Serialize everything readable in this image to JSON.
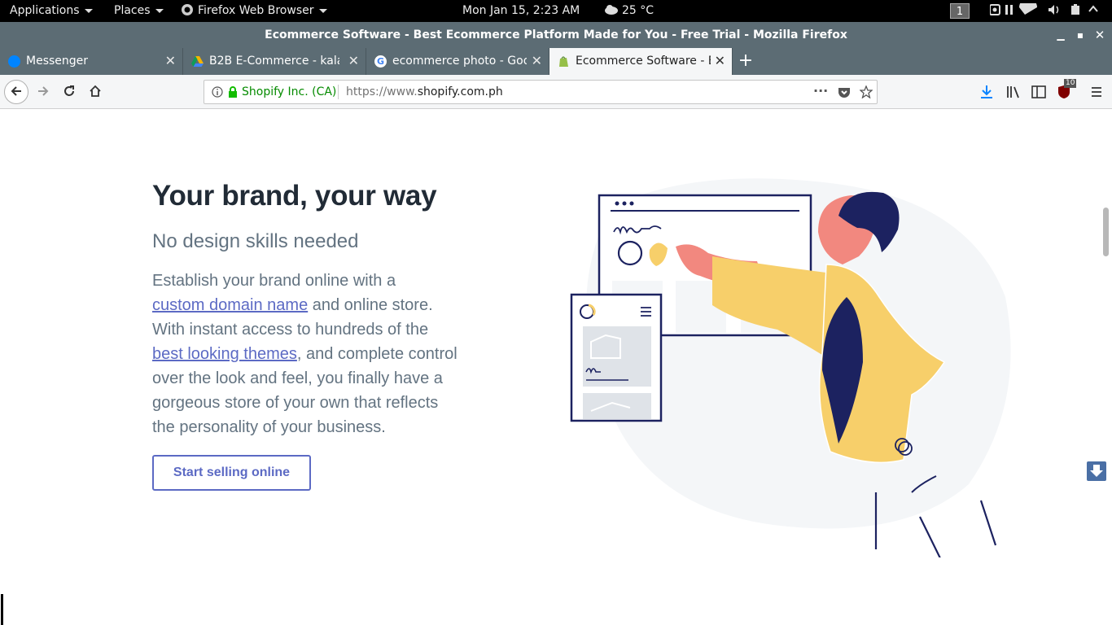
{
  "topbar": {
    "applications": "Applications",
    "places": "Places",
    "active_app": "Firefox Web Browser",
    "clock": "Mon Jan 15,  2:23 AM",
    "weather": "25 °C",
    "workspace": "1"
  },
  "window": {
    "title": "Ecommerce Software - Best Ecommerce Platform Made for You - Free Trial - Mozilla Firefox"
  },
  "tabs": [
    {
      "label": "Messenger",
      "icon": "messenger-icon",
      "color": "#0084ff"
    },
    {
      "label": "B2B E-Commerce - kalaka",
      "icon": "google-drive-icon",
      "color": "#f4b400"
    },
    {
      "label": "ecommerce photo - Goog",
      "icon": "google-icon",
      "color": "#4285f4"
    },
    {
      "label": "Ecommerce Software - Be",
      "icon": "shopify-icon",
      "color": "#96bf48"
    }
  ],
  "navbar": {
    "identity": "Shopify Inc. (CA)",
    "url_prefix": "https://www.",
    "url_domain": "shopify.com.ph",
    "addon_badge": "10"
  },
  "content": {
    "heading": "Your brand, your way",
    "subheading": "No design skills needed",
    "p1": "Establish your brand online with a",
    "link1": "custom domain name",
    "p2": " and online store. With instant access to hundreds of the",
    "link2": "best looking themes",
    "p3": ", and complete control over the look and feel, you finally have a gorgeous store of your own that reflects the personality of your business.",
    "cta": "Start selling online"
  },
  "colors": {
    "accent": "#5c6ac4",
    "heading": "#212b36",
    "body": "#637381",
    "secure": "#12bc00"
  }
}
